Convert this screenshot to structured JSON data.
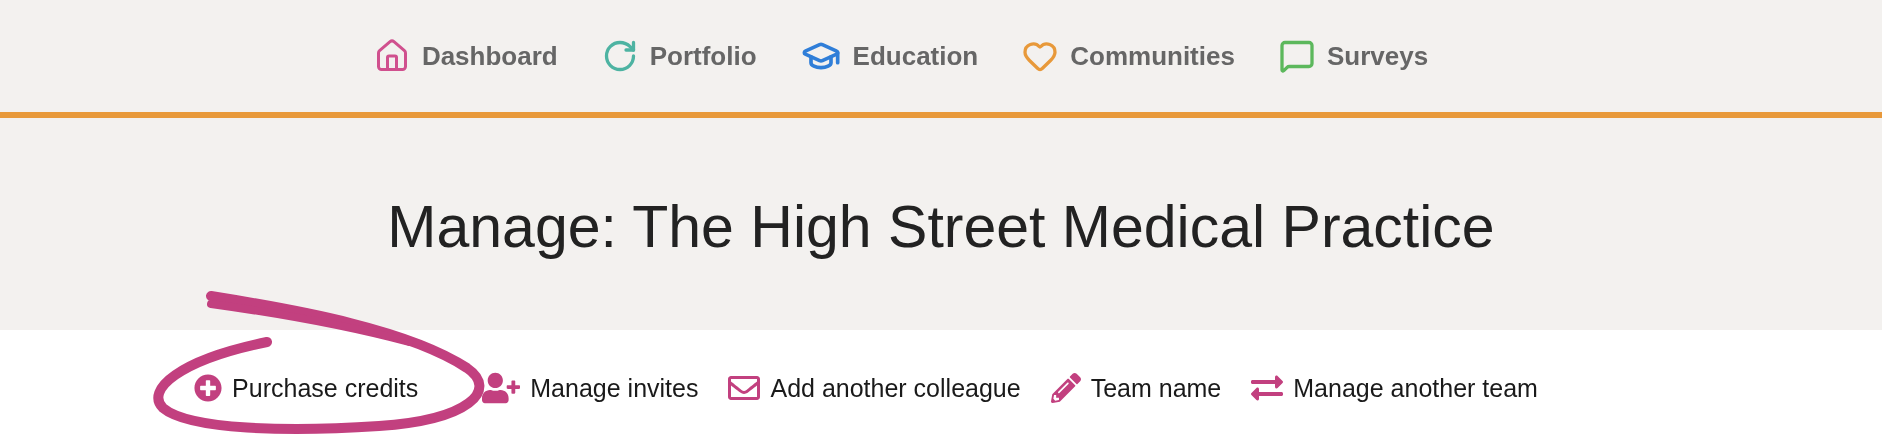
{
  "nav": [
    {
      "label": "Dashboard"
    },
    {
      "label": "Portfolio"
    },
    {
      "label": "Education"
    },
    {
      "label": "Communities"
    },
    {
      "label": "Surveys"
    }
  ],
  "title": "Manage: The High Street Medical Practice",
  "actions": [
    {
      "label": "Purchase credits",
      "circled": true
    },
    {
      "label": "Manage invites",
      "circled": false
    },
    {
      "label": "Add another colleague",
      "circled": false
    },
    {
      "label": "Team name",
      "circled": false
    },
    {
      "label": "Manage another team",
      "circled": false
    }
  ]
}
